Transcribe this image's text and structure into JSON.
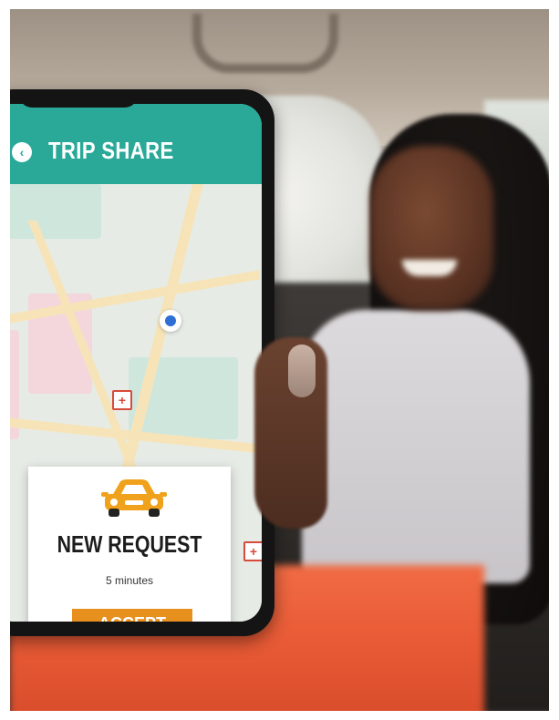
{
  "app": {
    "title": "TRIP SHARE",
    "header_color": "#2aa999"
  },
  "header": {
    "back_icon": "chevron-left-icon",
    "back_glyph": "‹"
  },
  "map": {
    "location_pin_icon": "location-dot-icon",
    "poi_icons": [
      "hospital-icon",
      "hospital-icon",
      "hospital-icon"
    ],
    "poi_glyph": "+"
  },
  "request_card": {
    "icon": "car-icon",
    "car_color": "#f0a21d",
    "title": "NEW REQUEST",
    "subtitle": "5 minutes",
    "accept_label": "ACCEPT",
    "accept_color": "#e8901e"
  }
}
